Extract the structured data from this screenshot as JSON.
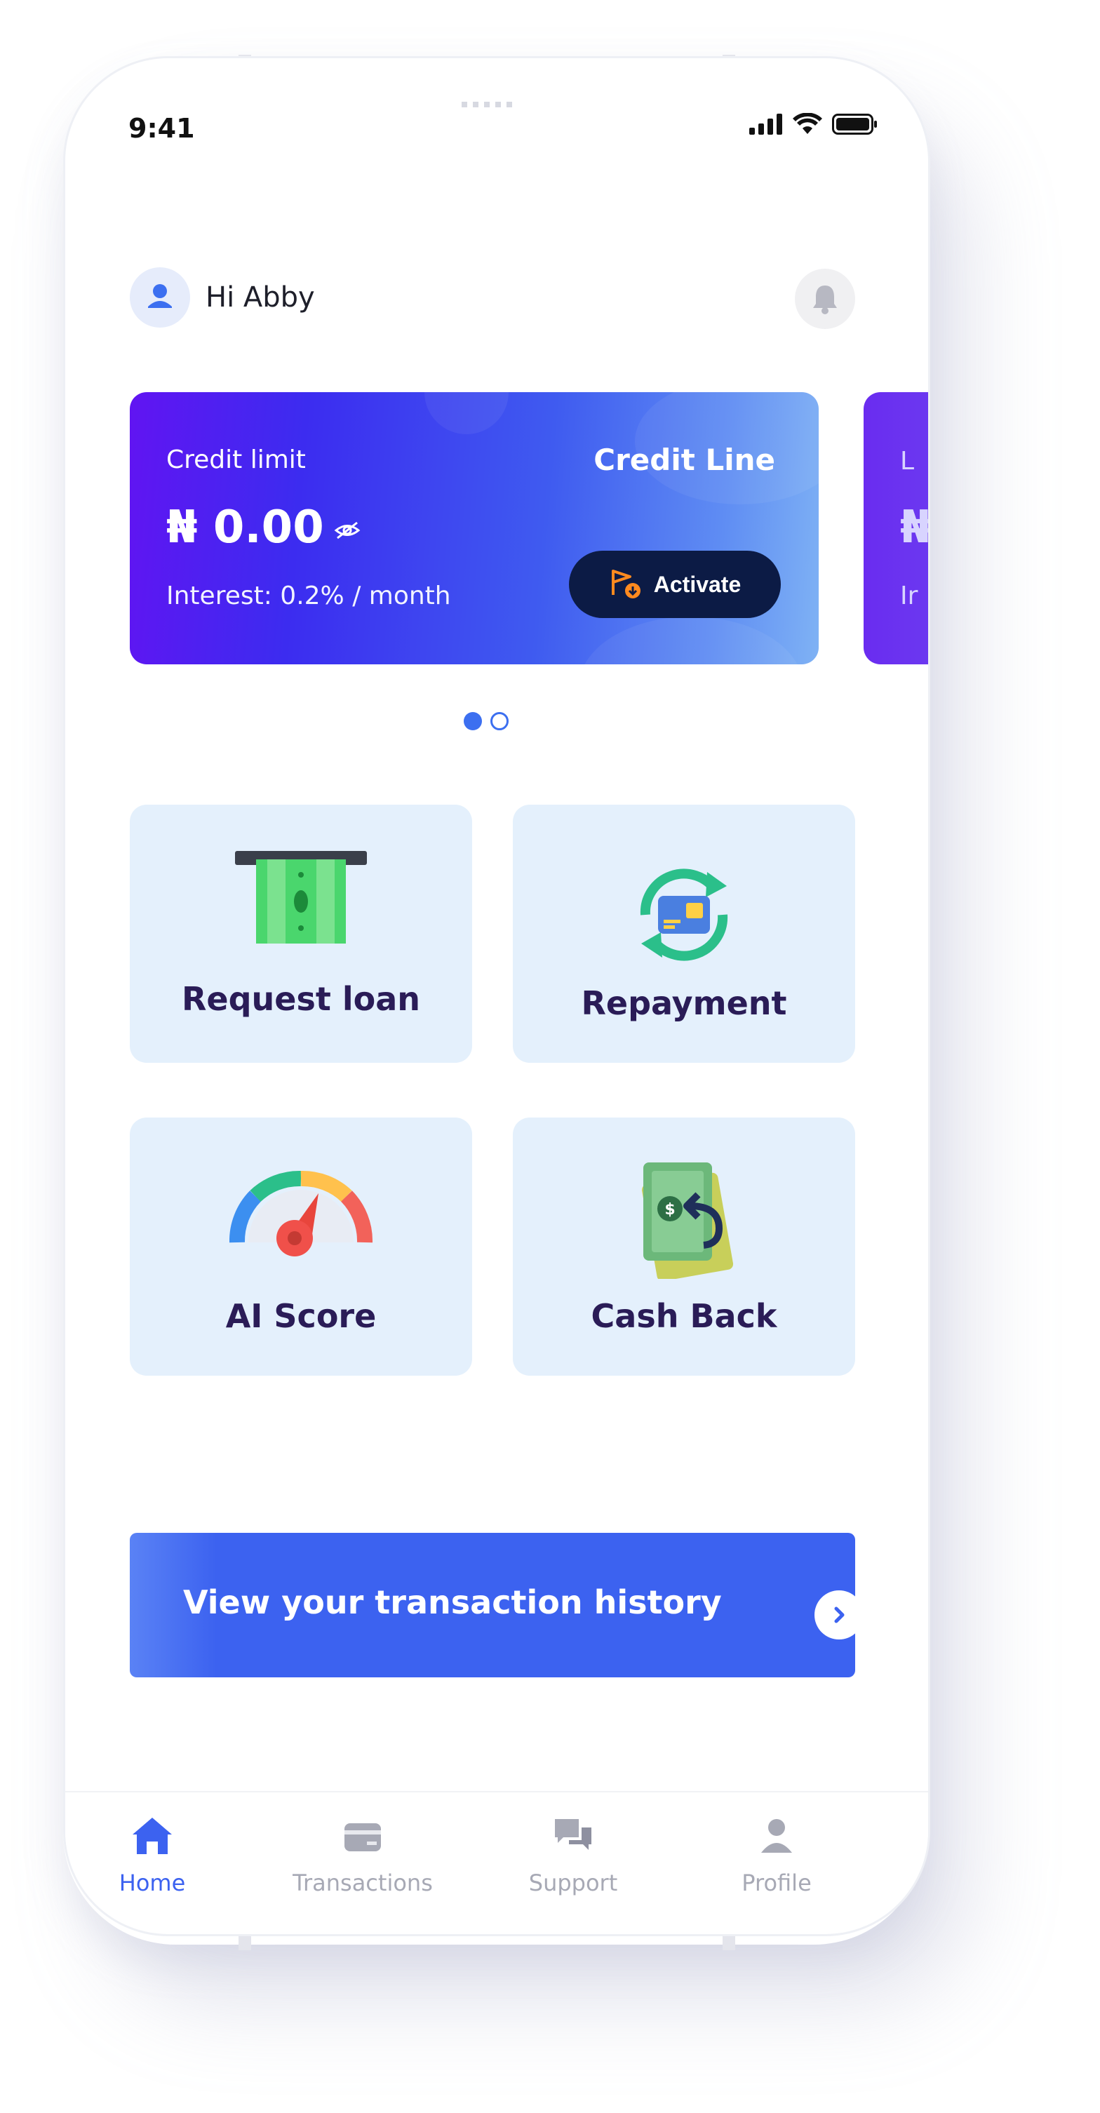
{
  "status_bar": {
    "time": "9:41"
  },
  "header": {
    "greeting": "Hi Abby"
  },
  "credit_card": {
    "label": "Credit limit",
    "title": "Credit Line",
    "amount": "₦ 0.00",
    "interest": "Interest: 0.2% / month",
    "activate_label": "Activate"
  },
  "peek_card": {
    "label": "L",
    "amount": "₦",
    "interest": "Ir"
  },
  "carousel": {
    "pages": 2,
    "active": 0
  },
  "tiles": [
    {
      "label": "Request loan",
      "icon": "atm-cash-icon"
    },
    {
      "label": "Repayment",
      "icon": "card-cycle-icon"
    },
    {
      "label": "AI Score",
      "icon": "gauge-icon"
    },
    {
      "label": "Cash Back",
      "icon": "cash-back-icon"
    }
  ],
  "history_button": {
    "label": "View your transaction history",
    "icon": "chevron-right-icon"
  },
  "tabbar": {
    "items": [
      {
        "label": "Home",
        "icon": "home-icon",
        "active": true
      },
      {
        "label": "Transactions",
        "icon": "card-icon",
        "active": false
      },
      {
        "label": "Support",
        "icon": "chat-icon",
        "active": false
      },
      {
        "label": "Profile",
        "icon": "person-icon",
        "active": false
      }
    ]
  },
  "colors": {
    "accent": "#3c62f0",
    "tile_bg": "#e4f0fc",
    "tile_text": "#2a1c57",
    "tab_inactive": "#a7a9b5"
  }
}
